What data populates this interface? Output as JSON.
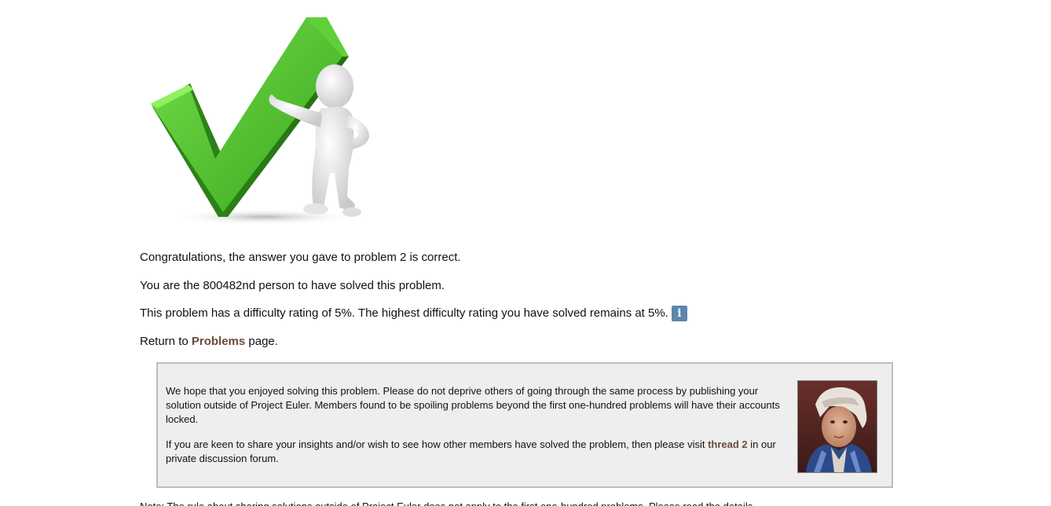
{
  "hero": {
    "icon": "checkmark-figure-illustration"
  },
  "result": {
    "congrats": "Congratulations, the answer you gave to problem 2 is correct.",
    "solver_count": "You are the 800482nd person to have solved this problem.",
    "difficulty": "This problem has a difficulty rating of 5%. The highest difficulty rating you have solved remains at 5%.",
    "info_glyph": "i",
    "return_prefix": "Return to ",
    "return_link": "Problems",
    "return_suffix": " page."
  },
  "notice": {
    "paragraph1": "We hope that you enjoyed solving this problem. Please do not deprive others of going through the same process by publishing your solution outside of Project Euler. Members found to be spoiling problems beyond the first one-hundred problems will have their accounts locked.",
    "paragraph2_prefix": "If you are keen to share your insights and/or wish to see how other members have solved the problem, then please visit ",
    "thread_link": "thread 2",
    "paragraph2_suffix": " in our private discussion forum.",
    "portrait_icon": "euler-portrait"
  },
  "footnote": {
    "text": "Note: The rule about sharing solutions outside of Project Euler does not apply to the first one-hundred problems. Please read the details"
  },
  "colors": {
    "link": "#6b4a3a",
    "info_button": "#5b86ad",
    "notice_background": "#eeeeee",
    "check_green": "#4dc22e"
  }
}
